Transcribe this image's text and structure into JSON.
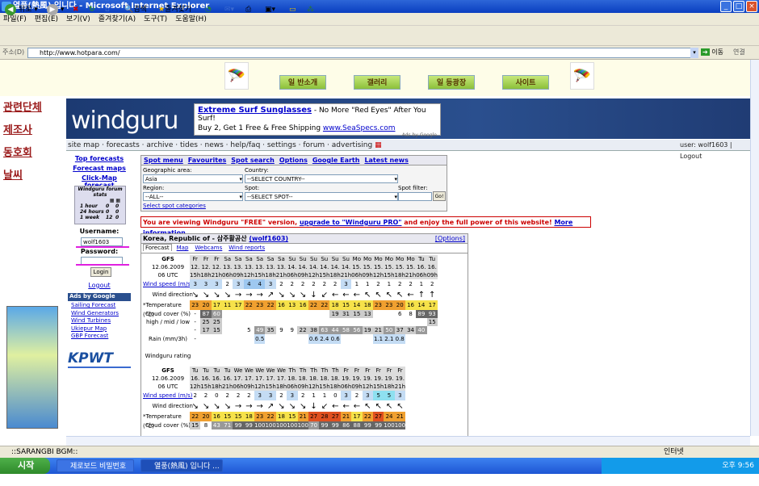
{
  "window": {
    "title": "열풍(熱風) 입니다 - Microsoft Internet Explorer"
  },
  "menu": [
    "파일(F)",
    "편집(E)",
    "보기(V)",
    "즐겨찾기(A)",
    "도구(T)",
    "도움말(H)"
  ],
  "toolbar": {
    "back": "뒤로",
    "search": "검색",
    "favorites": "즐겨찾기"
  },
  "address": {
    "label": "주소(D)",
    "url": "http://www.hotpara.com/",
    "go": "이동",
    "links": "연결"
  },
  "site": {
    "nav": [
      "일 반소개",
      "갤러리",
      "일 등광장",
      "사이트"
    ],
    "left_links": [
      "관련단체",
      "제조사",
      "동호회",
      "날씨"
    ]
  },
  "wg": {
    "logo": "windguru",
    "ad_title": "Extreme Surf Sunglasses",
    "ad_desc": " - No More \"Red Eyes\" After You Surf!",
    "ad_line2": "Buy 2, Get 1 Free & Free Shipping ",
    "ad_link": "www.SeaSpecs.com",
    "ads_by": "Ads by Google",
    "menu": "site map · forecasts · archive · tides · news · help/faq · settings · forum · advertising",
    "user": "user: wolf1603 | Logout",
    "left": {
      "top": "Top forecasts",
      "maps": "Forecast maps",
      "click": "Click-Map forecast",
      "stats": "Windguru forum stats",
      "stats_rows": [
        [
          "1 hour",
          "0",
          "0"
        ],
        [
          "24 hours",
          "0",
          "0"
        ],
        [
          "1 week",
          "12",
          "0"
        ]
      ],
      "username_label": "Username:",
      "username": "wolf1603",
      "password_label": "Password:",
      "login": "Login",
      "logout": "Logout",
      "ads_google": "Ads by Google",
      "ads": [
        "Sailing Forecast",
        "Wind Generators",
        "Wind Turbines",
        "Ukiepur Map",
        "GBP Forecast"
      ],
      "kpwt": "KPWT"
    },
    "search": {
      "tabs": [
        "Spot menu",
        "Favourites",
        "Spot search",
        "Options",
        "Google Earth",
        "Latest news"
      ],
      "area_label": "Geographic area:",
      "area": "Asia",
      "country_label": "Country:",
      "country": "--SELECT COUNTRY--",
      "region_label": "Region:",
      "region": "--ALL--",
      "spot_label": "Spot:",
      "spot": "--SELECT SPOT--",
      "filter_label": "Spot filter:",
      "go": "Go!",
      "cats": "Select spot categories"
    },
    "notice_a": "You are viewing Windguru \"FREE\" version, ",
    "notice_b": "upgrade to \"Windguru PRO\"",
    "notice_c": " and enjoy the full power of this website! ",
    "notice_d": "More information...",
    "forecast": {
      "title": "Korea, Republic of - 삼주활공산",
      "user": "(wolf1603)",
      "options": "[Options]",
      "tabs": [
        "Forecast",
        "Map",
        "Webcams",
        "Wind reports"
      ],
      "gfs": "GFS",
      "date": "12.06.2009",
      "utc": "06 UTC",
      "row_labels": [
        "Wind speed (m/s)",
        "Wind direction",
        "*Temperature (°C)",
        "Cloud cover (%)",
        "high / mid / low",
        "Rain (mm/3h)",
        "Windguru rating"
      ],
      "days": [
        "Fr",
        "Fr",
        "Fr",
        "Sa",
        "Sa",
        "Sa",
        "Sa",
        "Sa",
        "Sa",
        "Su",
        "Su",
        "Su",
        "Su",
        "Su",
        "Su",
        "Mo",
        "Mo",
        "Mo",
        "Mo",
        "Mo",
        "Mo",
        "Tu",
        "Tu"
      ],
      "dates": [
        "12.",
        "12.",
        "12.",
        "13.",
        "13.",
        "13.",
        "13.",
        "13.",
        "13.",
        "14.",
        "14.",
        "14.",
        "14.",
        "14.",
        "14.",
        "15.",
        "15.",
        "15.",
        "15.",
        "15.",
        "15.",
        "16.",
        "16."
      ],
      "hours": [
        "15h",
        "18h",
        "21h",
        "06h",
        "09h",
        "12h",
        "15h",
        "18h",
        "21h",
        "06h",
        "09h",
        "12h",
        "15h",
        "18h",
        "21h",
        "06h",
        "09h",
        "12h",
        "15h",
        "18h",
        "21h",
        "06h",
        "09h"
      ],
      "wind": [
        "3",
        "3",
        "3",
        "2",
        "3",
        "4",
        "4",
        "3",
        "2",
        "2",
        "2",
        "2",
        "2",
        "2",
        "3",
        "1",
        "1",
        "2",
        "1",
        "2",
        "2",
        "1",
        "2"
      ],
      "temp": [
        "23",
        "20",
        "17",
        "11",
        "17",
        "22",
        "23",
        "22",
        "16",
        "13",
        "16",
        "22",
        "22",
        "18",
        "15",
        "14",
        "18",
        "23",
        "23",
        "20",
        "16",
        "14",
        "17"
      ],
      "cloud_h": [
        "-",
        "87",
        "60",
        "",
        "",
        "",
        "",
        "",
        "",
        "",
        "",
        "",
        "",
        "19",
        "31",
        "15",
        "13",
        "",
        "",
        "6",
        "8",
        "89",
        "93"
      ],
      "cloud_m": [
        "-",
        "25",
        "25",
        "",
        "",
        "",
        "",
        "",
        "",
        "",
        "",
        "",
        "",
        "",
        "",
        "",
        "",
        "",
        "",
        "",
        "",
        "",
        "15"
      ],
      "cloud_l": [
        "-",
        "17",
        "15",
        "",
        "",
        "5",
        "49",
        "35",
        "9",
        "9",
        "22",
        "38",
        "63",
        "44",
        "58",
        "56",
        "19",
        "21",
        "50",
        "37",
        "34",
        "40",
        ""
      ],
      "rain": [
        "-",
        "",
        "",
        "",
        "",
        "",
        "0.5",
        "",
        "",
        "",
        "",
        "0.6",
        "2.4",
        "0.6",
        "",
        "",
        "",
        "1.1",
        "2.1",
        "0.8",
        "",
        "",
        ""
      ],
      "days2": [
        "Tu",
        "Tu",
        "Tu",
        "Tu",
        "We",
        "We",
        "We",
        "We",
        "We",
        "Th",
        "Th",
        "Th",
        "Th",
        "Th",
        "Fr",
        "Fr",
        "Fr",
        "Fr",
        "Fr",
        "Fr"
      ],
      "dates2": [
        "16.",
        "16.",
        "16.",
        "16.",
        "17.",
        "17.",
        "17.",
        "17.",
        "17.",
        "18.",
        "18.",
        "18.",
        "18.",
        "18.",
        "19.",
        "19.",
        "19.",
        "19.",
        "19.",
        "19."
      ],
      "hours2": [
        "12h",
        "15h",
        "18h",
        "21h",
        "06h",
        "09h",
        "12h",
        "15h",
        "18h",
        "06h",
        "09h",
        "12h",
        "15h",
        "18h",
        "06h",
        "09h",
        "12h",
        "15h",
        "18h",
        "21h"
      ],
      "wind2": [
        "2",
        "2",
        "0",
        "2",
        "2",
        "2",
        "3",
        "3",
        "2",
        "3",
        "2",
        "1",
        "1",
        "0",
        "3",
        "2",
        "3",
        "5",
        "5",
        "3"
      ],
      "temp2": [
        "22",
        "20",
        "16",
        "15",
        "15",
        "18",
        "23",
        "22",
        "18",
        "15",
        "21",
        "27",
        "28",
        "27",
        "21",
        "17",
        "22",
        "27",
        "24",
        "21"
      ],
      "cloud2": [
        "15",
        "8",
        "43",
        "71",
        "99",
        "99",
        "100",
        "100",
        "100",
        "100",
        "100",
        "70",
        "99",
        "99",
        "86",
        "88",
        "99",
        "99",
        "100",
        "100"
      ]
    }
  },
  "statusbar": {
    "left": "::SARANGBI BGM::",
    "zone": "인터넷"
  },
  "taskbar": {
    "start": "시작",
    "tasks": [
      "제로보드 비밀번호 ...",
      "열풍(熱風) 입니다 ..."
    ],
    "clock": "오후 9:56"
  }
}
